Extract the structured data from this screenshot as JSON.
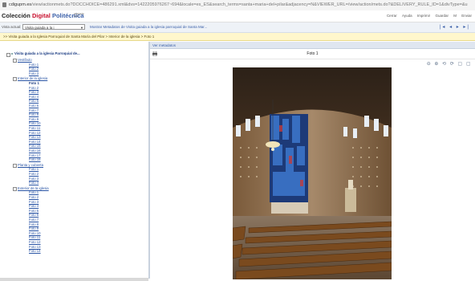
{
  "browser": {
    "url_prefix": "cdigupm.es",
    "url_rest": "/view/actionmets.do?DOCCHOICE=486291.xml&dvs=1422205976267~694&locale=es_ES&search_terms=santa+maria+del+pilar&adjacency=N&VIEWER_URL=/view/action/mets.do?&DELIVERY_RULE_ID=1&divType=&u"
  },
  "app": {
    "logo_part1": "Colección ",
    "logo_part2": "Digital ",
    "logo_part3": "Politécnica",
    "small_icon_text": "adaptada web",
    "top_links": [
      "Cerrar",
      "Ayuda",
      "Imprimir",
      "Guardar",
      "M",
      "Enviar"
    ]
  },
  "navbar": {
    "label": "Vista actual:",
    "select_value": "Visita guiada a la i",
    "crumb_1": "Mostrar Metadatos de",
    "crumb_2": "Visita guiada a la iglesia parroquial de Santa Mar...",
    "pager": "|◂ ◂ ▸ ▸|"
  },
  "path": ">> Visita guiada a la Iglesia Parroquial de Santa María del Pilar > Interior de la iglesia > Foto 1",
  "tree": {
    "root": "Visita guiada a la iglesia Parroquial de...",
    "sections": [
      {
        "label": "Vestíbulo",
        "items": [
          "Foto 1",
          "Foto 2",
          "Foto 3"
        ]
      },
      {
        "label": "Interior de la iglesia",
        "items": [
          "Foto 1",
          "Foto 2",
          "Foto 3",
          "Foto 4",
          "Foto 5",
          "Foto 6",
          "Foto 7",
          "Foto 8",
          "Foto 9",
          "Foto 10",
          "Foto 11",
          "Foto 12",
          "Foto 13",
          "Foto 14",
          "Foto 15",
          "Foto 16",
          "Foto 17",
          "Foto 18"
        ]
      },
      {
        "label": "Planta y cubierta",
        "items": [
          "Foto 1",
          "Foto 2",
          "Foto 3",
          "Foto 4"
        ]
      },
      {
        "label": "Exterior de la iglesia",
        "items": [
          "Foto 1",
          "Foto 2",
          "Foto 3",
          "Foto 4",
          "Foto 5",
          "Foto 6",
          "Foto 7",
          "Foto 8",
          "Foto 9",
          "Foto 10",
          "Foto 11",
          "Foto 12",
          "Foto 13",
          "Foto 14"
        ]
      }
    ]
  },
  "viewer": {
    "header": "Ver metadatos",
    "title": "Foto 1",
    "tools": "⊖ ⊕ ⟲ ⟳ ▢ ▢"
  },
  "colors": {
    "accent": "#3a5fa8",
    "path_bg": "#fff7cc",
    "logo_red": "#c8102e"
  }
}
